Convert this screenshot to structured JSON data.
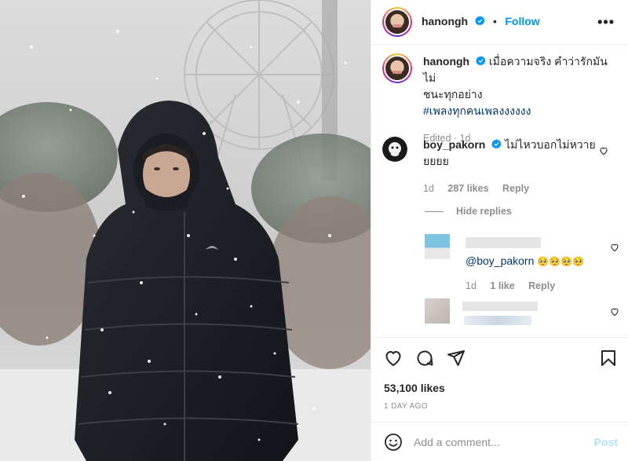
{
  "post": {
    "author": "hanongh",
    "follow_label": "Follow",
    "dot": "•",
    "more_label": "•••",
    "caption_line1": "เมื่อความจริง คำว่ารักมันไม่",
    "caption_line2": "ชนะทุกอย่าง",
    "caption_hashtag": "#เพลงทุกคนเพลงงงงงง",
    "edited": "Edited · 1d"
  },
  "comments": [
    {
      "author": "boy_pakorn",
      "text_line1": "ไม่ไหวบอกไม่หวาย",
      "text_line2": "ยยยย",
      "time": "1d",
      "likes": "287 likes",
      "reply_label": "Reply"
    }
  ],
  "hide_replies_label": "Hide replies",
  "replies": [
    {
      "mention": "@boy_pakorn",
      "emojis": "🥺🥺🥺🥺",
      "time": "1d",
      "likes": "1 like",
      "reply_label": "Reply"
    }
  ],
  "stats": {
    "likes": "53,100 likes",
    "time_ago": "1 DAY AGO"
  },
  "composer": {
    "placeholder": "Add a comment...",
    "post_label": "Post"
  },
  "colors": {
    "accent": "#0095f6",
    "hashtag": "#00376b",
    "muted": "#8e8e8e",
    "post_disabled": "#b2dffc"
  },
  "icons": [
    "verified-badge-icon",
    "more-options-icon",
    "heart-icon",
    "comment-icon",
    "share-icon",
    "bookmark-icon",
    "emoji-icon"
  ]
}
